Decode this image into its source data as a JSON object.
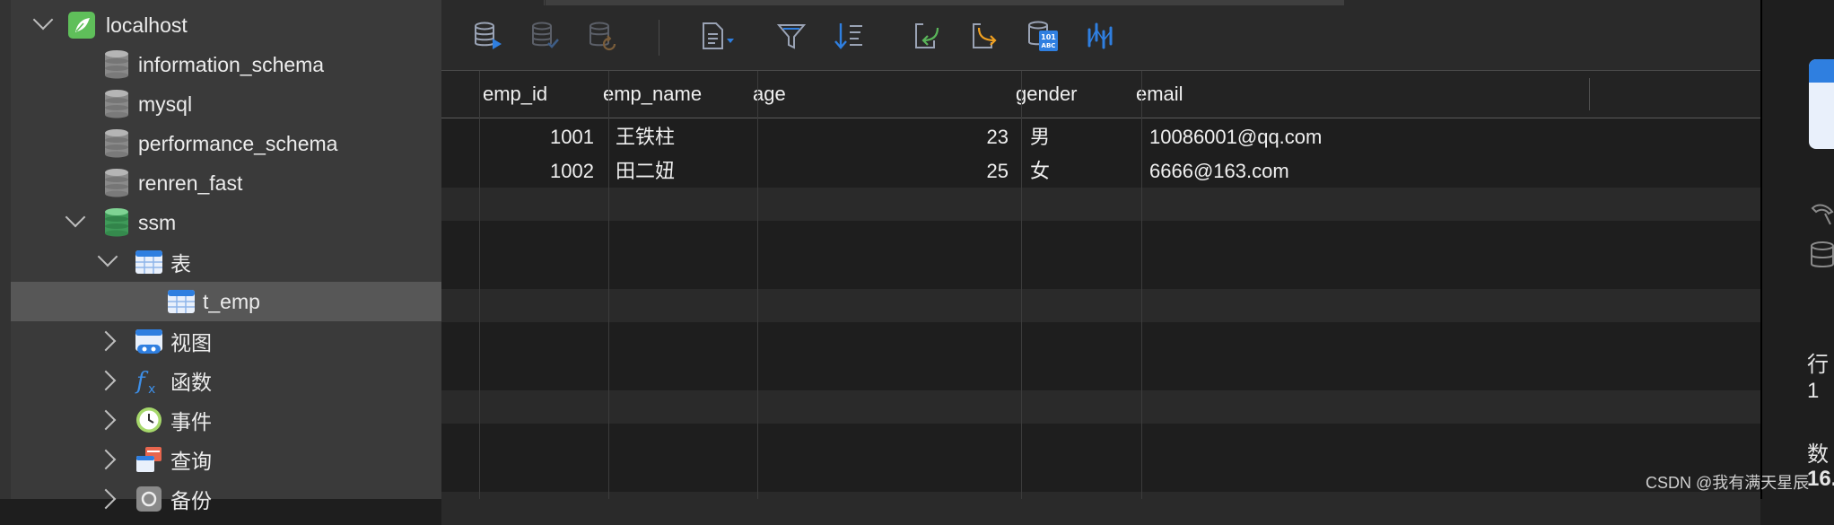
{
  "sidebar": {
    "connection": {
      "label": "localhost"
    },
    "databases": [
      {
        "label": "information_schema"
      },
      {
        "label": "mysql"
      },
      {
        "label": "performance_schema"
      },
      {
        "label": "renren_fast"
      },
      {
        "label": "ssm"
      }
    ],
    "ssm_children": {
      "tables_group": {
        "label": "表"
      },
      "table_item": {
        "label": "t_emp"
      },
      "views_group": {
        "label": "视图"
      },
      "functions_group": {
        "label": "函数"
      },
      "events_group": {
        "label": "事件"
      },
      "queries_group": {
        "label": "查询"
      },
      "backups_group": {
        "label": "备份"
      }
    }
  },
  "toolbar": {
    "icons": [
      "run-icon",
      "commit-icon",
      "refresh-icon",
      "document-dropdown-icon",
      "filter-icon",
      "sort-icon",
      "import-icon",
      "export-icon",
      "data-generator-icon",
      "chart-icon"
    ]
  },
  "grid": {
    "columns": [
      "emp_id",
      "emp_name",
      "age",
      "gender",
      "email"
    ],
    "rows": [
      {
        "emp_id": "1001",
        "emp_name": "王铁柱",
        "age": "23",
        "gender": "男",
        "email": "10086001@qq.com"
      },
      {
        "emp_id": "1002",
        "emp_name": "田二妞",
        "age": "25",
        "gender": "女",
        "email": "6666@163.com"
      }
    ]
  },
  "right_panel": {
    "row_label": "行",
    "row_value": "1",
    "data_label": "数",
    "data_value": "16."
  },
  "watermark": "CSDN @我有满天星辰",
  "colors": {
    "accent_blue": "#2f7fe0",
    "db_green": "#4bb36a",
    "sidebar_bg": "#3a3a3a",
    "grid_bg": "#1e1e1e"
  }
}
